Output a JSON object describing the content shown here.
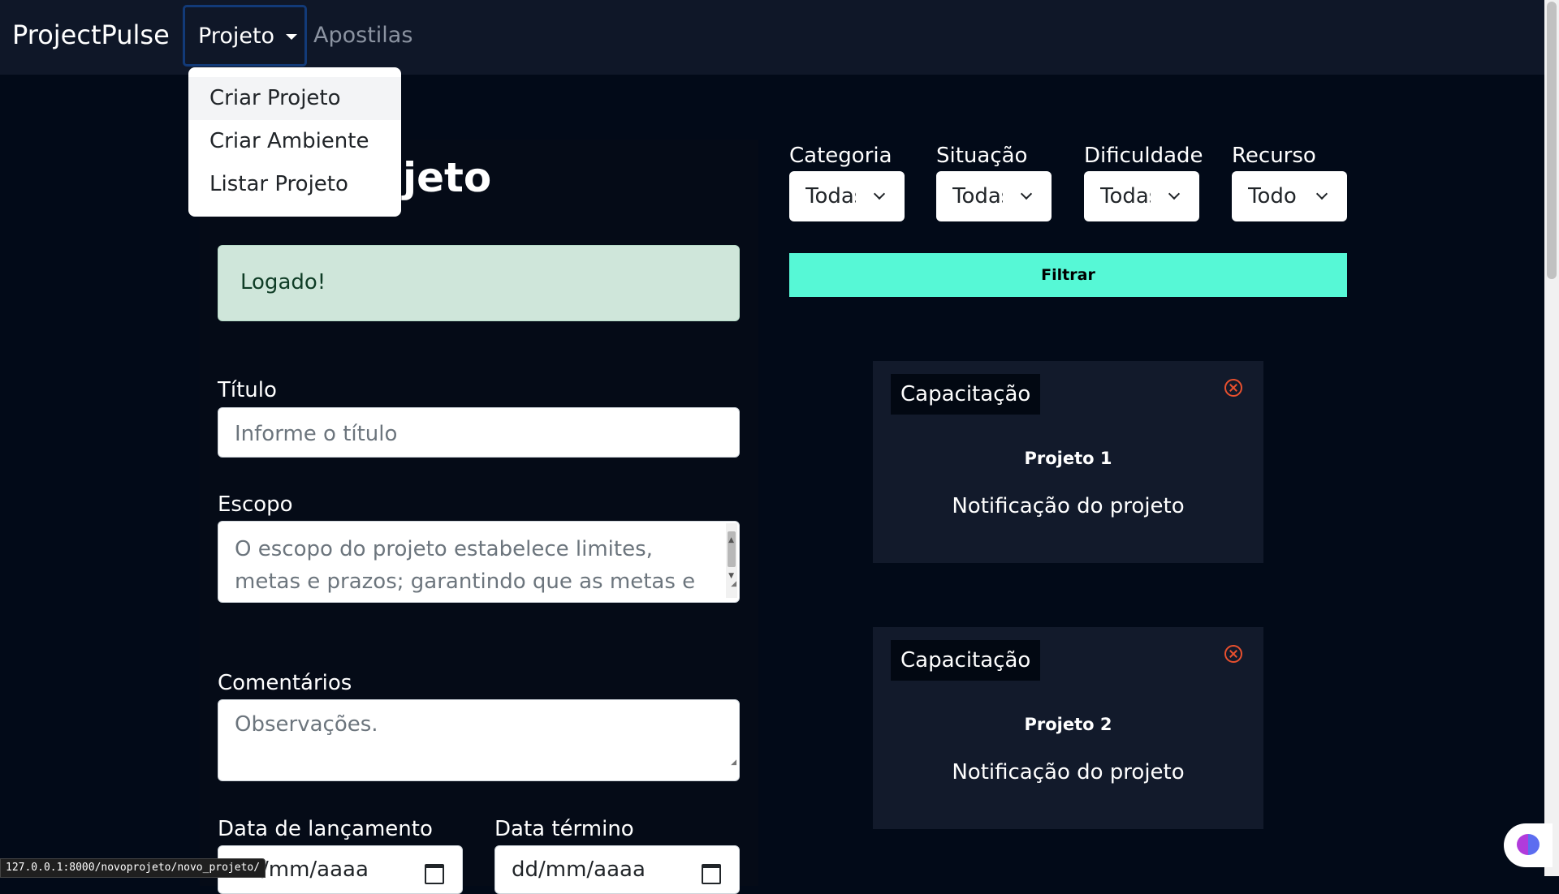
{
  "navbar": {
    "brand": "ProjectPulse",
    "items": [
      {
        "label": "Projeto"
      },
      {
        "label": "Apostilas"
      }
    ]
  },
  "dropdown": {
    "items": [
      {
        "label": "Criar Projeto"
      },
      {
        "label": "Criar Ambiente"
      },
      {
        "label": "Listar Projeto"
      }
    ]
  },
  "form": {
    "heading": "Criar Projeto",
    "alert": "Logado!",
    "titulo": {
      "label": "Título",
      "placeholder": "Informe o título"
    },
    "escopo": {
      "label": "Escopo",
      "placeholder": "O escopo do projeto estabelece limites, metas e prazos; garantindo que as metas e objetivos"
    },
    "comentarios": {
      "label": "Comentários",
      "placeholder": "Observações."
    },
    "data_lancamento": {
      "label": "Data de lançamento",
      "placeholder": "dd/mm/aaaa"
    },
    "data_termino": {
      "label": "Data término",
      "placeholder": "dd/mm/aaaa"
    }
  },
  "filters": {
    "selects": [
      {
        "label": "Categoria",
        "value": "Todas"
      },
      {
        "label": "Situação",
        "value": "Todas"
      },
      {
        "label": "Dificuldade",
        "value": "Todas"
      },
      {
        "label": "Recurso",
        "value": "Todo"
      }
    ],
    "button": "Filtrar"
  },
  "cards": [
    {
      "badge": "Capacitação",
      "title": "Projeto 1",
      "notification": "Notificação do projeto"
    },
    {
      "badge": "Capacitação",
      "title": "Projeto 2",
      "notification": "Notificação do projeto"
    }
  ],
  "status_url": "127.0.0.1:8000/novoprojeto/novo_projeto/",
  "colors": {
    "background": "#020a18",
    "navbar": "#0f1728",
    "filter_button": "#56f8d6",
    "alert_bg": "#cfe6da",
    "close_icon": "#e8502e"
  },
  "icons": [
    "caret-down-icon",
    "chevron-down-icon",
    "close-circle-icon",
    "calendar-icon",
    "brain-icon"
  ]
}
